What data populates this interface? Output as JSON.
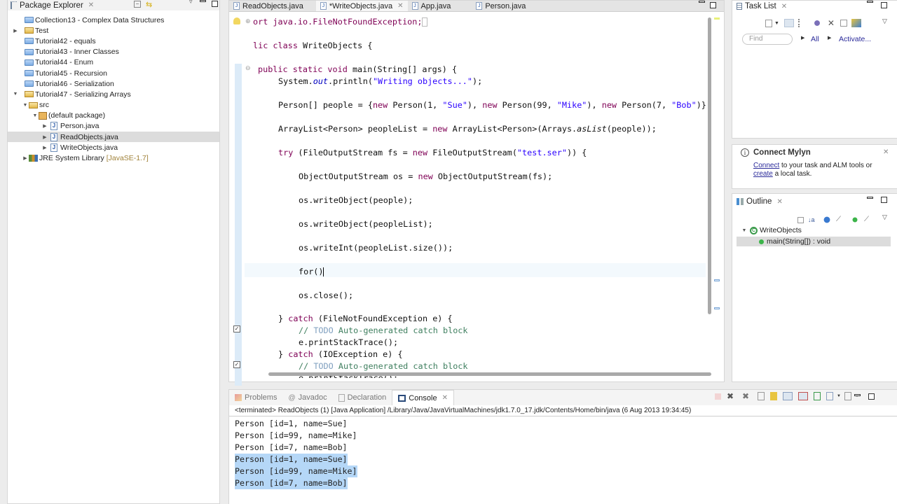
{
  "package_explorer": {
    "title": "Package Explorer",
    "items": [
      {
        "label": "Collection13 - Complex Data Structures",
        "icon": "project-folder-icon",
        "expanded": null
      },
      {
        "label": "Test",
        "icon": "project-open-icon",
        "expanded": false
      },
      {
        "label": "Tutorial42 - equals",
        "icon": "project-folder-icon",
        "expanded": null
      },
      {
        "label": "Tutorial43 - Inner Classes",
        "icon": "project-folder-icon",
        "expanded": null
      },
      {
        "label": "Tutorial44 - Enum",
        "icon": "project-folder-icon",
        "expanded": null
      },
      {
        "label": "Tutorial45 - Recursion",
        "icon": "project-folder-icon",
        "expanded": null
      },
      {
        "label": "Tutorial46 - Serialization",
        "icon": "project-folder-icon",
        "expanded": null
      },
      {
        "label": "Tutorial47 - Serializing Arrays",
        "icon": "project-open-icon",
        "expanded": true
      },
      {
        "label": "src",
        "icon": "source-folder-icon",
        "expanded": true
      },
      {
        "label": "(default package)",
        "icon": "package-icon",
        "expanded": true
      },
      {
        "label": "Person.java",
        "icon": "java-file-icon",
        "expanded": false
      },
      {
        "label": "ReadObjects.java",
        "icon": "java-file-icon",
        "expanded": false,
        "selected": true
      },
      {
        "label": "WriteObjects.java",
        "icon": "java-file-icon",
        "expanded": false
      },
      {
        "label": "JRE System Library",
        "decoration": "[JavaSE-1.7]",
        "icon": "library-icon",
        "expanded": false
      }
    ]
  },
  "editor": {
    "tabs": [
      {
        "label": "ReadObjects.java",
        "active": false
      },
      {
        "label": "*WriteObjects.java",
        "active": true
      },
      {
        "label": "App.java",
        "active": false
      },
      {
        "label": "Person.java",
        "active": false
      }
    ],
    "code": {
      "l1": "ort java.io.FileNotFoundException;",
      "l2_kw": "lic class",
      "l2": " WriteObjects {",
      "l3_kw": "public static void",
      "l3": " main(String[] args) {",
      "l4a": "System.",
      "l4b": "out",
      "l4c": ".println(",
      "l4s": "\"Writing objects...\"",
      "l4d": ");",
      "l5a": "Person[] people = {",
      "new": "new",
      "l5b": " Person(1, ",
      "l5s1": "\"Sue\"",
      "l5c": "), ",
      "l5d": " Person(99, ",
      "l5s2": "\"Mike\"",
      "l5e": " Person(7, ",
      "l5s3": "\"Bob\"",
      "l5f": ")};",
      "l6a": "ArrayList<Person> peopleList = ",
      "l6b": " ArrayList<Person>(Arrays.",
      "l6c": "asList",
      "l6d": "(people));",
      "l7kw": "try",
      "l7a": " (FileOutputStream fs = ",
      "l7b": " FileOutputStream(",
      "l7s": "\"test.ser\"",
      "l7c": ")) {",
      "l8a": "ObjectOutputStream os = ",
      "l8b": " ObjectOutputStream(fs);",
      "l9": "os.writeObject(people);",
      "l10": "os.writeObject(peopleList);",
      "l11": "os.writeInt(peopleList.size());",
      "l12": "for()",
      "l13": "os.close();",
      "l14a": "} ",
      "catch": "catch",
      "l14b": " (FileNotFoundException e) {",
      "cm1": "// ",
      "todo": "TODO",
      "cm2": " Auto-generated catch block",
      "l16": "e.printStackTrace();",
      "l17b": " (IOException e) {",
      "l19": "e.printStackTrace();"
    }
  },
  "task_list": {
    "title": "Task List",
    "find_placeholder": "Find",
    "filter_all": "All",
    "activate": "Activate..."
  },
  "mylyn": {
    "title": "Connect Mylyn",
    "connect_link": "Connect",
    "text1": " to your task and ALM tools or",
    "create_link": "create",
    "text2": " a local task."
  },
  "outline": {
    "title": "Outline",
    "class_name": "WriteObjects",
    "method": "main(String[]) : void"
  },
  "console": {
    "tabs": [
      {
        "label": "Problems",
        "active": false
      },
      {
        "label": "Javadoc",
        "active": false
      },
      {
        "label": "Declaration",
        "active": false
      },
      {
        "label": "Console",
        "active": true
      }
    ],
    "status": "<terminated> ReadObjects (1) [Java Application] /Library/Java/JavaVirtualMachines/jdk1.7.0_17.jdk/Contents/Home/bin/java (6 Aug 2013 19:34:45)",
    "lines": [
      {
        "text": "Person [id=1, name=Sue]",
        "selected": false
      },
      {
        "text": "Person [id=99, name=Mike]",
        "selected": false
      },
      {
        "text": "Person [id=7, name=Bob]",
        "selected": false
      },
      {
        "text": "Person [id=1, name=Sue]",
        "selected": true
      },
      {
        "text": "Person [id=99, name=Mike]",
        "selected": true
      },
      {
        "text": "Person [id=7, name=Bob]",
        "selected": true
      }
    ]
  }
}
